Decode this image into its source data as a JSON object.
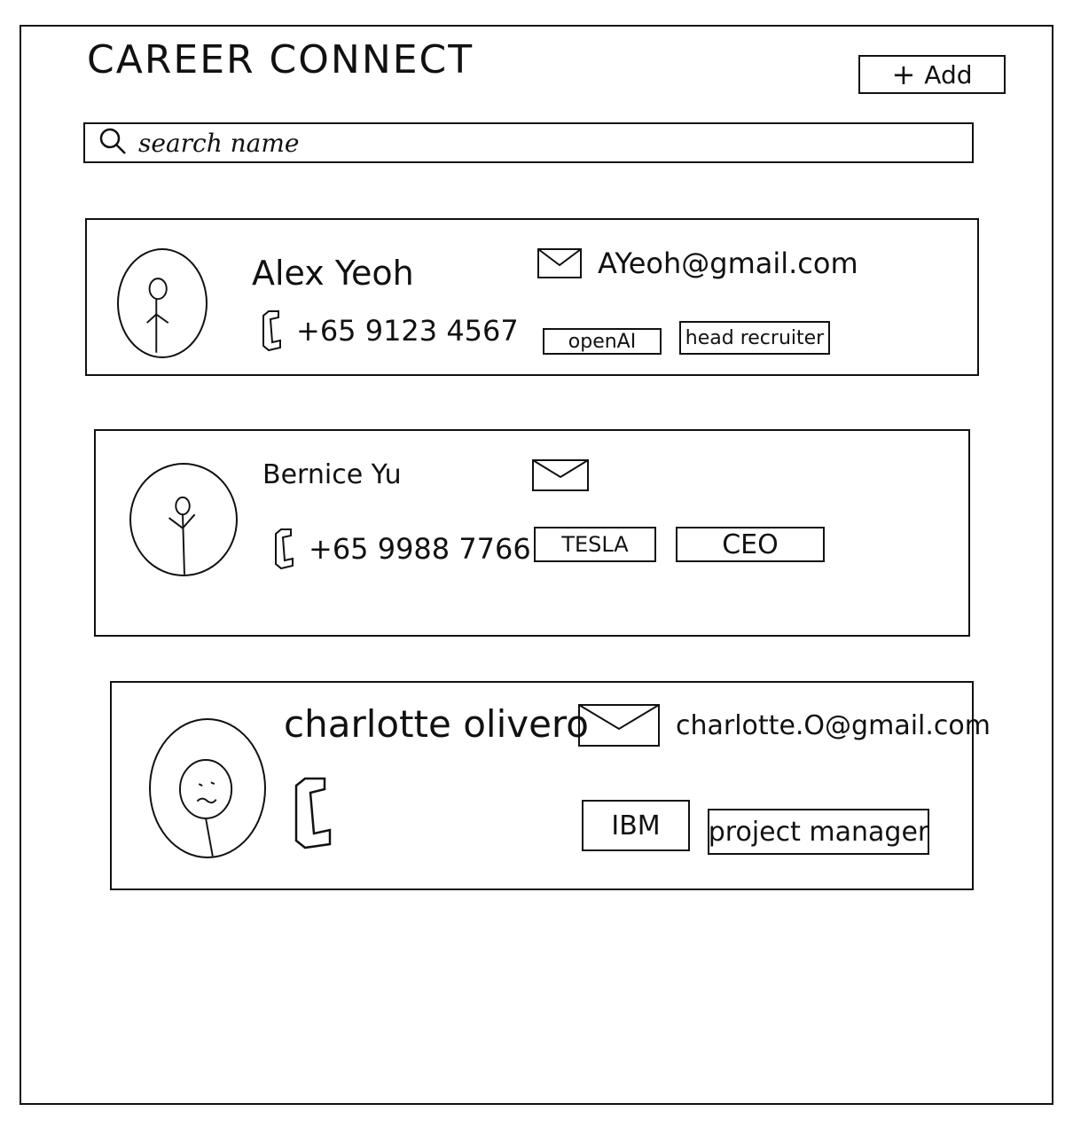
{
  "app": {
    "title": "CAREER CONNECT",
    "add_label": "Add"
  },
  "search": {
    "placeholder": "search name"
  },
  "contacts": [
    {
      "name": "Alex Yeoh",
      "email": "AYeoh@gmail.com",
      "phone": "+65 9123 4567",
      "company": "openAI",
      "role": "head recruiter"
    },
    {
      "name": "Bernice Yu",
      "email": "",
      "phone": "+65 9988 7766",
      "company": "TESLA",
      "role": "CEO"
    },
    {
      "name": "charlotte olivero",
      "email": "charlotte.O@gmail.com",
      "phone": "",
      "company": "IBM",
      "role": "project manager"
    }
  ]
}
